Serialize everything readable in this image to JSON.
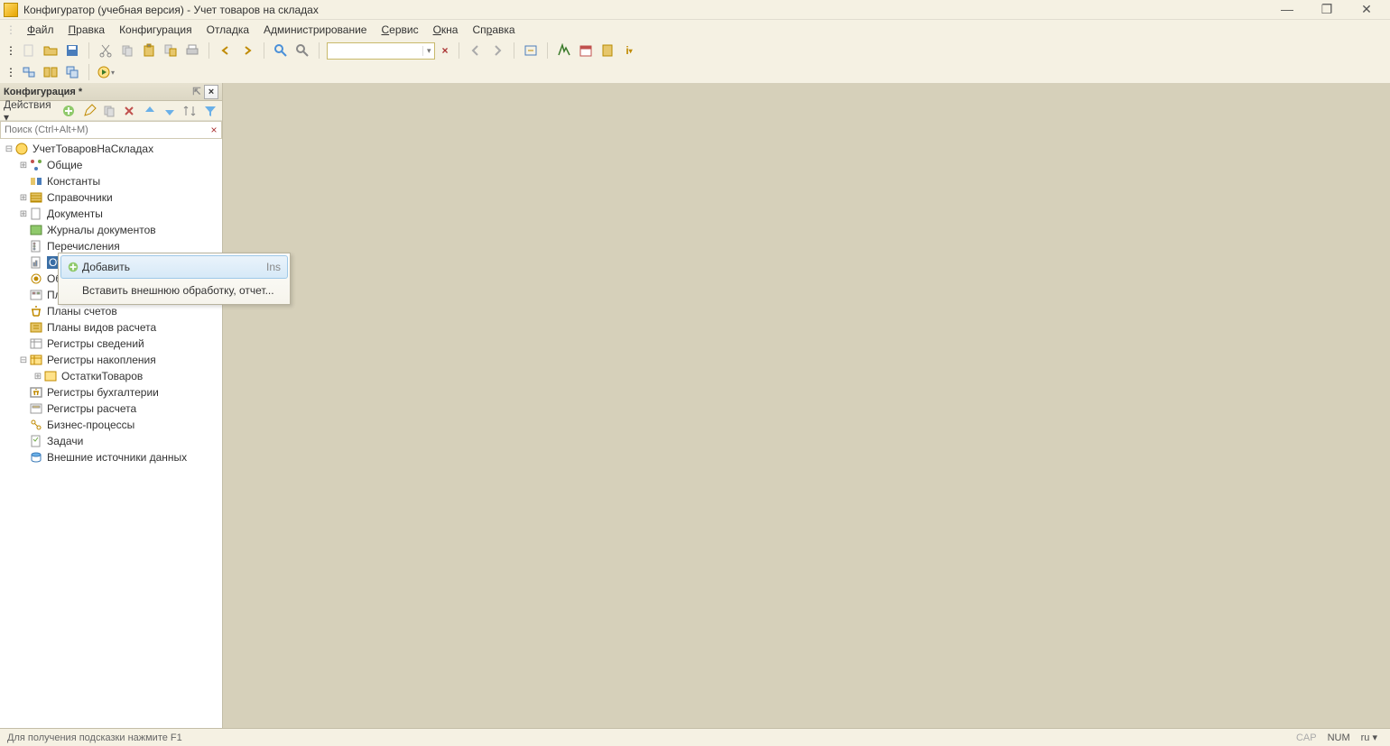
{
  "title": "Конфигуратор (учебная версия) - Учет товаров на складах",
  "menu": {
    "file": "Файл",
    "edit": "Правка",
    "config": "Конфигурация",
    "debug": "Отладка",
    "admin": "Администрирование",
    "service": "Сервис",
    "windows": "Окна",
    "help": "Справка"
  },
  "panel": {
    "title": "Конфигурация *",
    "actions_label": "Действия",
    "search_placeholder": "Поиск (Ctrl+Alt+M)"
  },
  "tree": {
    "root": "УчетТоваровНаСкладах",
    "common": "Общие",
    "constants": "Константы",
    "catalogs": "Справочники",
    "documents": "Документы",
    "doc_journals": "Журналы документов",
    "enumerations": "Перечисления",
    "reports": "Отчеты",
    "data_processors": "Обработки",
    "chart_char_types": "Планы видов характеристик",
    "chart_accounts": "Планы счетов",
    "chart_calc_types": "Планы видов расчета",
    "info_registers": "Регистры сведений",
    "accum_registers": "Регистры накопления",
    "accum_child": "ОстаткиТоваров",
    "accounting_registers": "Регистры бухгалтерии",
    "calc_registers": "Регистры расчета",
    "business_processes": "Бизнес-процессы",
    "tasks": "Задачи",
    "external_sources": "Внешние источники данных"
  },
  "context_menu": {
    "add": "Добавить",
    "add_shortcut": "Ins",
    "insert_external": "Вставить внешнюю обработку, отчет..."
  },
  "status": {
    "hint": "Для получения подсказки нажмите F1",
    "cap": "CAP",
    "num": "NUM",
    "lang": "ru"
  }
}
